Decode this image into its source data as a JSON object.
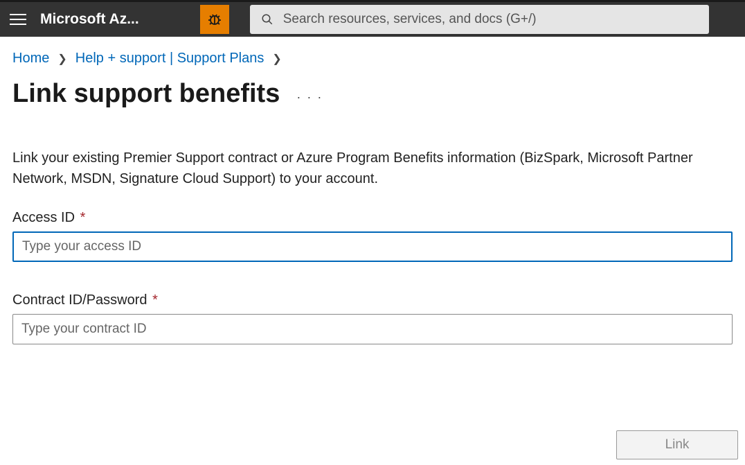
{
  "header": {
    "brand": "Microsoft Az...",
    "search_placeholder": "Search resources, services, and docs (G+/)"
  },
  "breadcrumb": {
    "home": "Home",
    "help_support": "Help + support | Support Plans"
  },
  "page": {
    "title": "Link support benefits",
    "description": "Link your existing Premier Support contract or Azure Program Benefits information (BizSpark, Microsoft Partner Network, MSDN, Signature Cloud Support) to your account."
  },
  "form": {
    "access_id": {
      "label": "Access ID",
      "placeholder": "Type your access ID",
      "value": ""
    },
    "contract_id": {
      "label": "Contract ID/Password",
      "placeholder": "Type your contract ID",
      "value": ""
    }
  },
  "buttons": {
    "link": "Link"
  }
}
